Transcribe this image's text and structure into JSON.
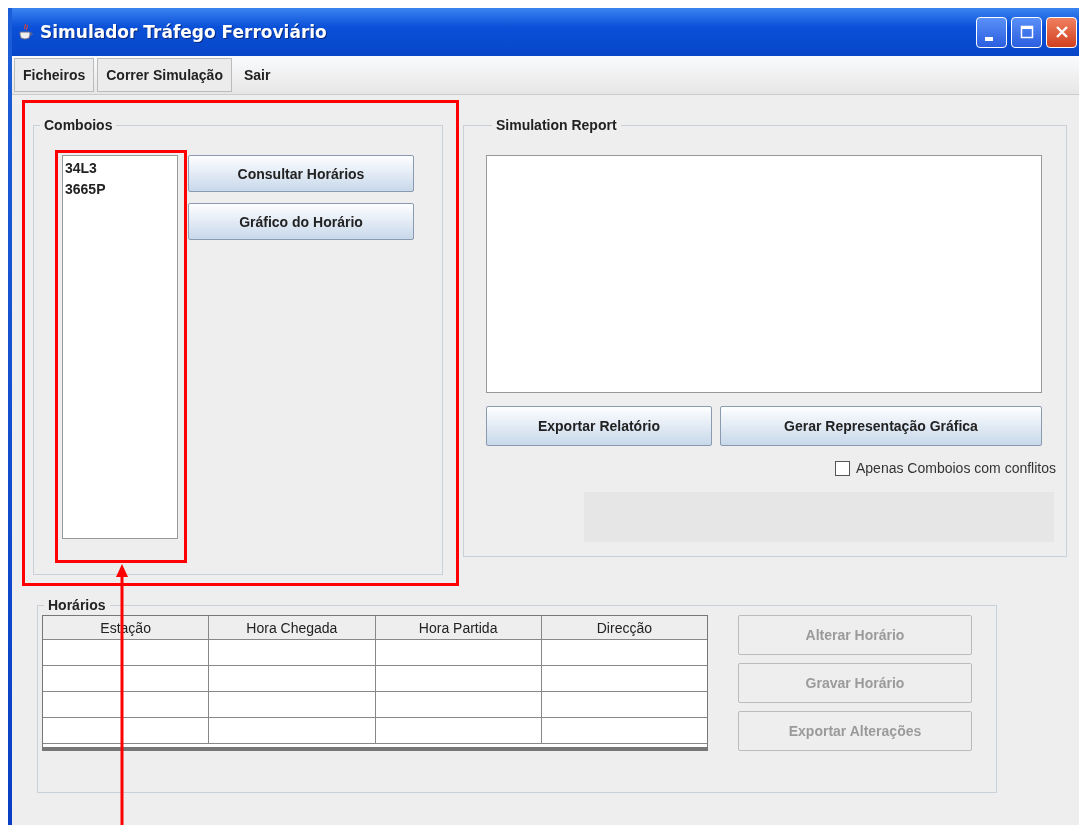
{
  "window": {
    "title": "Simulador Tráfego Ferroviário"
  },
  "menu": [
    {
      "label": "Ficheiros",
      "selected": true
    },
    {
      "label": "Correr Simulação",
      "selected": true
    },
    {
      "label": "Sair",
      "selected": false
    }
  ],
  "comboios": {
    "title": "Comboios",
    "items": [
      {
        "label": "34L3",
        "selected": false
      },
      {
        "label": "3665P",
        "selected": false
      }
    ],
    "buttons": [
      {
        "label": "Consultar Horários",
        "disabled": false
      },
      {
        "label": "Gráfico do Horário",
        "disabled": false
      }
    ]
  },
  "simulation_report": {
    "title": "Simulation Report",
    "buttons": [
      {
        "label": "Exportar Relatório",
        "disabled": false
      },
      {
        "label": "Gerar Representação Gráfica",
        "disabled": false
      }
    ],
    "filter": {
      "label": "Apenas Comboios com conflitos",
      "checked": false
    }
  },
  "horarios": {
    "title": "Horários",
    "columns": [
      "Estação",
      "Hora Chegada",
      "Hora Partida",
      "Direcção"
    ],
    "buttons": [
      {
        "label": "Alterar Horário",
        "disabled": true
      },
      {
        "label": "Gravar Horário",
        "disabled": true
      },
      {
        "label": "Exportar Alterações",
        "disabled": true
      }
    ]
  }
}
